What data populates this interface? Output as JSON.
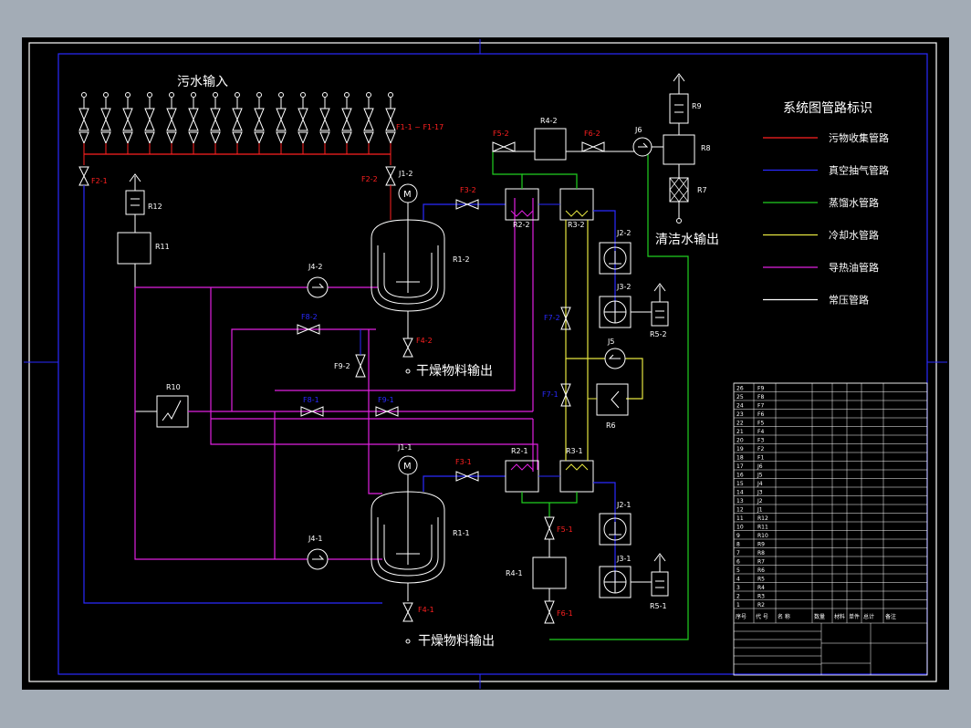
{
  "title_inlet": "污水输入",
  "legend": {
    "title": "系统图管路标识",
    "items": [
      {
        "label": "污物收集管路",
        "color": "#ff2020"
      },
      {
        "label": "真空抽气管路",
        "color": "#2a2aff"
      },
      {
        "label": "蒸馏水管路",
        "color": "#20d020"
      },
      {
        "label": "冷却水管路",
        "color": "#e6e640"
      },
      {
        "label": "导热油管路",
        "color": "#e020e0"
      },
      {
        "label": "常压管路",
        "color": "#ffffff"
      }
    ]
  },
  "labels": {
    "f1": "F1-1 ~ F1-17",
    "f2_1": "F2-1",
    "f2_2": "F2-2",
    "f3_1": "F3-1",
    "f3_2": "F3-2",
    "f4_1": "F4-1",
    "f4_2": "F4-2",
    "f5_1": "F5-1",
    "f5_2": "F5-2",
    "f6_1": "F6-1",
    "f6_2": "F6-2",
    "f7_1": "F7-1",
    "f7_2": "F7-2",
    "f8_1": "F8-1",
    "f8_2": "F8-2",
    "f9_1": "F9-1",
    "f9_2": "F9-2",
    "r1_1": "R1-1",
    "r1_2": "R1-2",
    "r2_1": "R2-1",
    "r2_2": "R2-2",
    "r3_1": "R3-1",
    "r3_2": "R3-2",
    "r4_1": "R4-1",
    "r4_2": "R4-2",
    "r5_1": "R5-1",
    "r5_2": "R5-2",
    "r6": "R6",
    "r7": "R7",
    "r8": "R8",
    "r9": "R9",
    "r10": "R10",
    "r11": "R11",
    "r12": "R12",
    "j1_1": "J1-1",
    "j1_2": "J1-2",
    "j2_1": "J2-1",
    "j2_2": "J2-2",
    "j3_1": "J3-1",
    "j3_2": "J3-2",
    "j4_1": "J4-1",
    "j4_2": "J4-2",
    "j5": "J5",
    "j6": "J6",
    "motor": "M"
  },
  "outputs": {
    "clean_water": "清洁水输出",
    "dry_material_top": "干燥物料输出",
    "dry_material_bottom": "干燥物料输出"
  },
  "parts_table": {
    "rows": [
      [
        "26",
        "F9",
        "",
        ""
      ],
      [
        "25",
        "F8",
        "",
        ""
      ],
      [
        "24",
        "F7",
        "",
        ""
      ],
      [
        "23",
        "F6",
        "",
        ""
      ],
      [
        "22",
        "F5",
        "",
        ""
      ],
      [
        "21",
        "F4",
        "",
        ""
      ],
      [
        "20",
        "F3",
        "",
        ""
      ],
      [
        "19",
        "F2",
        "",
        ""
      ],
      [
        "18",
        "F1",
        "",
        ""
      ],
      [
        "17",
        "J6",
        "",
        ""
      ],
      [
        "16",
        "J5",
        "",
        ""
      ],
      [
        "15",
        "J4",
        "",
        ""
      ],
      [
        "14",
        "J3",
        "",
        ""
      ],
      [
        "13",
        "J2",
        "",
        ""
      ],
      [
        "12",
        "J1",
        "",
        ""
      ],
      [
        "11",
        "R12",
        "",
        ""
      ],
      [
        "10",
        "R11",
        "",
        ""
      ],
      [
        "9",
        "R10",
        "",
        ""
      ],
      [
        "8",
        "R9",
        "",
        ""
      ],
      [
        "7",
        "R8",
        "",
        ""
      ],
      [
        "6",
        "R7",
        "",
        ""
      ],
      [
        "5",
        "R6",
        "",
        ""
      ],
      [
        "4",
        "R5",
        "",
        ""
      ],
      [
        "3",
        "R4",
        "",
        ""
      ],
      [
        "2",
        "R3",
        "",
        ""
      ],
      [
        "1",
        "R2",
        "",
        ""
      ]
    ],
    "header": [
      "序号",
      "代 号",
      "名 称",
      "数量",
      "材料",
      "单件",
      "总计",
      "备注"
    ]
  }
}
